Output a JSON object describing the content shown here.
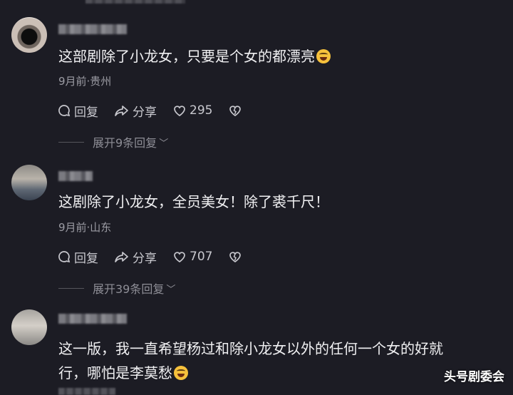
{
  "comments": [
    {
      "text": "这部剧除了小龙女，只要是个女的都漂亮",
      "meta": "9月前·贵州",
      "reply_label": "回复",
      "share_label": "分享",
      "likes": "295",
      "expand_label": "展开9条回复",
      "icons": [
        "reply-bubble-icon",
        "share-arrow-icon",
        "heart-icon",
        "broken-heart-icon",
        "laughing-emoji-icon"
      ]
    },
    {
      "text": "这剧除了小龙女，全员美女！除了裘千尺！",
      "meta": "9月前·山东",
      "reply_label": "回复",
      "share_label": "分享",
      "likes": "707",
      "expand_label": "展开39条回复"
    },
    {
      "text": "这一版，我一直希望杨过和除小龙女以外的任何一个女的好就行，哪怕是李莫愁",
      "text_line1": "这一版，我一直希望杨过和除小龙女以外的任何一个女的好就",
      "text_line2": "行，哪怕是李莫愁"
    }
  ],
  "watermark": "头号剧委会",
  "colors": {
    "background": "#1c1c24",
    "text": "#f0f0f2",
    "meta": "#9c9ca4",
    "emoji": "#f6c13c"
  }
}
